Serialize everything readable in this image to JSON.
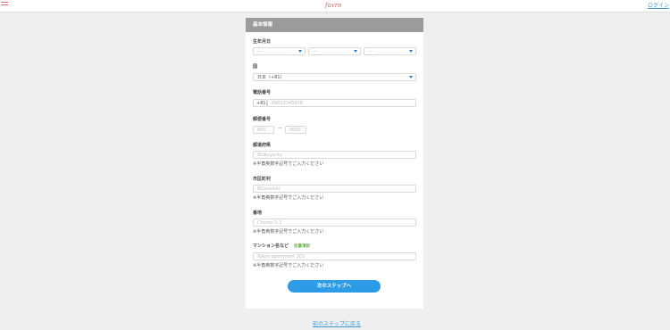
{
  "header": {
    "logo_text": "favro",
    "login_label": "ログイン"
  },
  "form": {
    "section_title": "基本情報",
    "birthdate": {
      "label": "生年月日",
      "year_value": "---",
      "month_value": "---",
      "day_value": "---"
    },
    "country": {
      "label": "国",
      "value": "日本（+81）"
    },
    "phone": {
      "label": "電話番号",
      "prefix": "+81",
      "placeholder": "09012345678"
    },
    "postal": {
      "label": "郵便番号",
      "placeholder1": "000",
      "separator": "—",
      "placeholder2": "0000"
    },
    "prefecture": {
      "label": "都道府県",
      "placeholder": "Shibuya-ku",
      "note": "※半角英数字記号でご入力ください"
    },
    "city": {
      "label": "市区町村",
      "placeholder": "Ebisunishi",
      "note": "※半角英数字記号でご入力ください"
    },
    "address": {
      "label": "番地",
      "placeholder": "Chome 1-1",
      "note": "※半角英数字記号でご入力ください"
    },
    "building": {
      "label": "マンション名など",
      "optional_badge": "任意項目",
      "placeholder": "Tokyo apartment 203",
      "note": "※半角英数字記号でご入力ください"
    },
    "next_button": "次のステップへ"
  },
  "footer": {
    "back_link": "前のステップに戻る"
  },
  "colors": {
    "accent": "#2d9be6",
    "header_bar": "#9b9b9b",
    "logo": "#e05a5a",
    "optional_badge": "#5aaa3a"
  }
}
